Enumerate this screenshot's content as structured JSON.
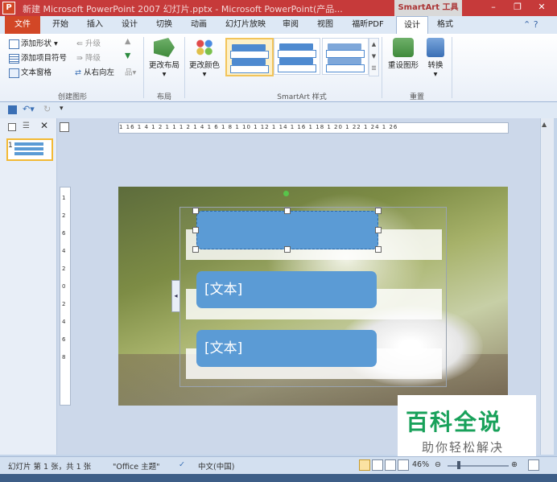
{
  "window": {
    "title": "新建 Microsoft PowerPoint 2007 幻灯片.pptx - Microsoft PowerPoint(产品...",
    "app_icon_letter": "P",
    "contextual_tools_label": "SmartArt 工具",
    "controls": {
      "minimize": "–",
      "restore": "❐",
      "close": "✕"
    }
  },
  "tabs": [
    "文件",
    "开始",
    "插入",
    "设计",
    "切换",
    "动画",
    "幻灯片放映",
    "审阅",
    "视图",
    "福昕PDF",
    "设计",
    "格式"
  ],
  "help": "⌃ ?",
  "ribbon": {
    "create_graphic": {
      "label": "创建图形",
      "add_shape": "添加形状",
      "add_bullet": "添加项目符号",
      "text_pane": "文本窗格",
      "promote": "升级",
      "demote": "降级",
      "rtl": "从右向左",
      "move_up": "▲",
      "move_down": "▼"
    },
    "layout": {
      "label": "布局",
      "change_layout": "更改布局"
    },
    "change_colors": "更改颜色",
    "styles_label": "SmartArt 样式",
    "reset": {
      "label": "重置",
      "reset_graphic": "重设图形",
      "convert": "转换"
    }
  },
  "slide": {
    "rulers_h": "1 16 1 4 1 2 1 1 1 2 1 4 1 6 1 8 1 10 1 12 1 14 1 16 1 18 1 20 1 22 1 24 1 26",
    "rulers_v": "12 6 4 2 0 2 4 6 8",
    "boxes": [
      "",
      "[文本]",
      "[文本]"
    ],
    "thumb_number": "1"
  },
  "watermark": {
    "title": "百科全说",
    "subtitle": "助你轻松解决"
  },
  "status": {
    "slide_info": "幻灯片 第 1 张，共 1 张",
    "theme": "\"Office 主题\"",
    "language": "中文(中国)",
    "zoom": "46%"
  }
}
